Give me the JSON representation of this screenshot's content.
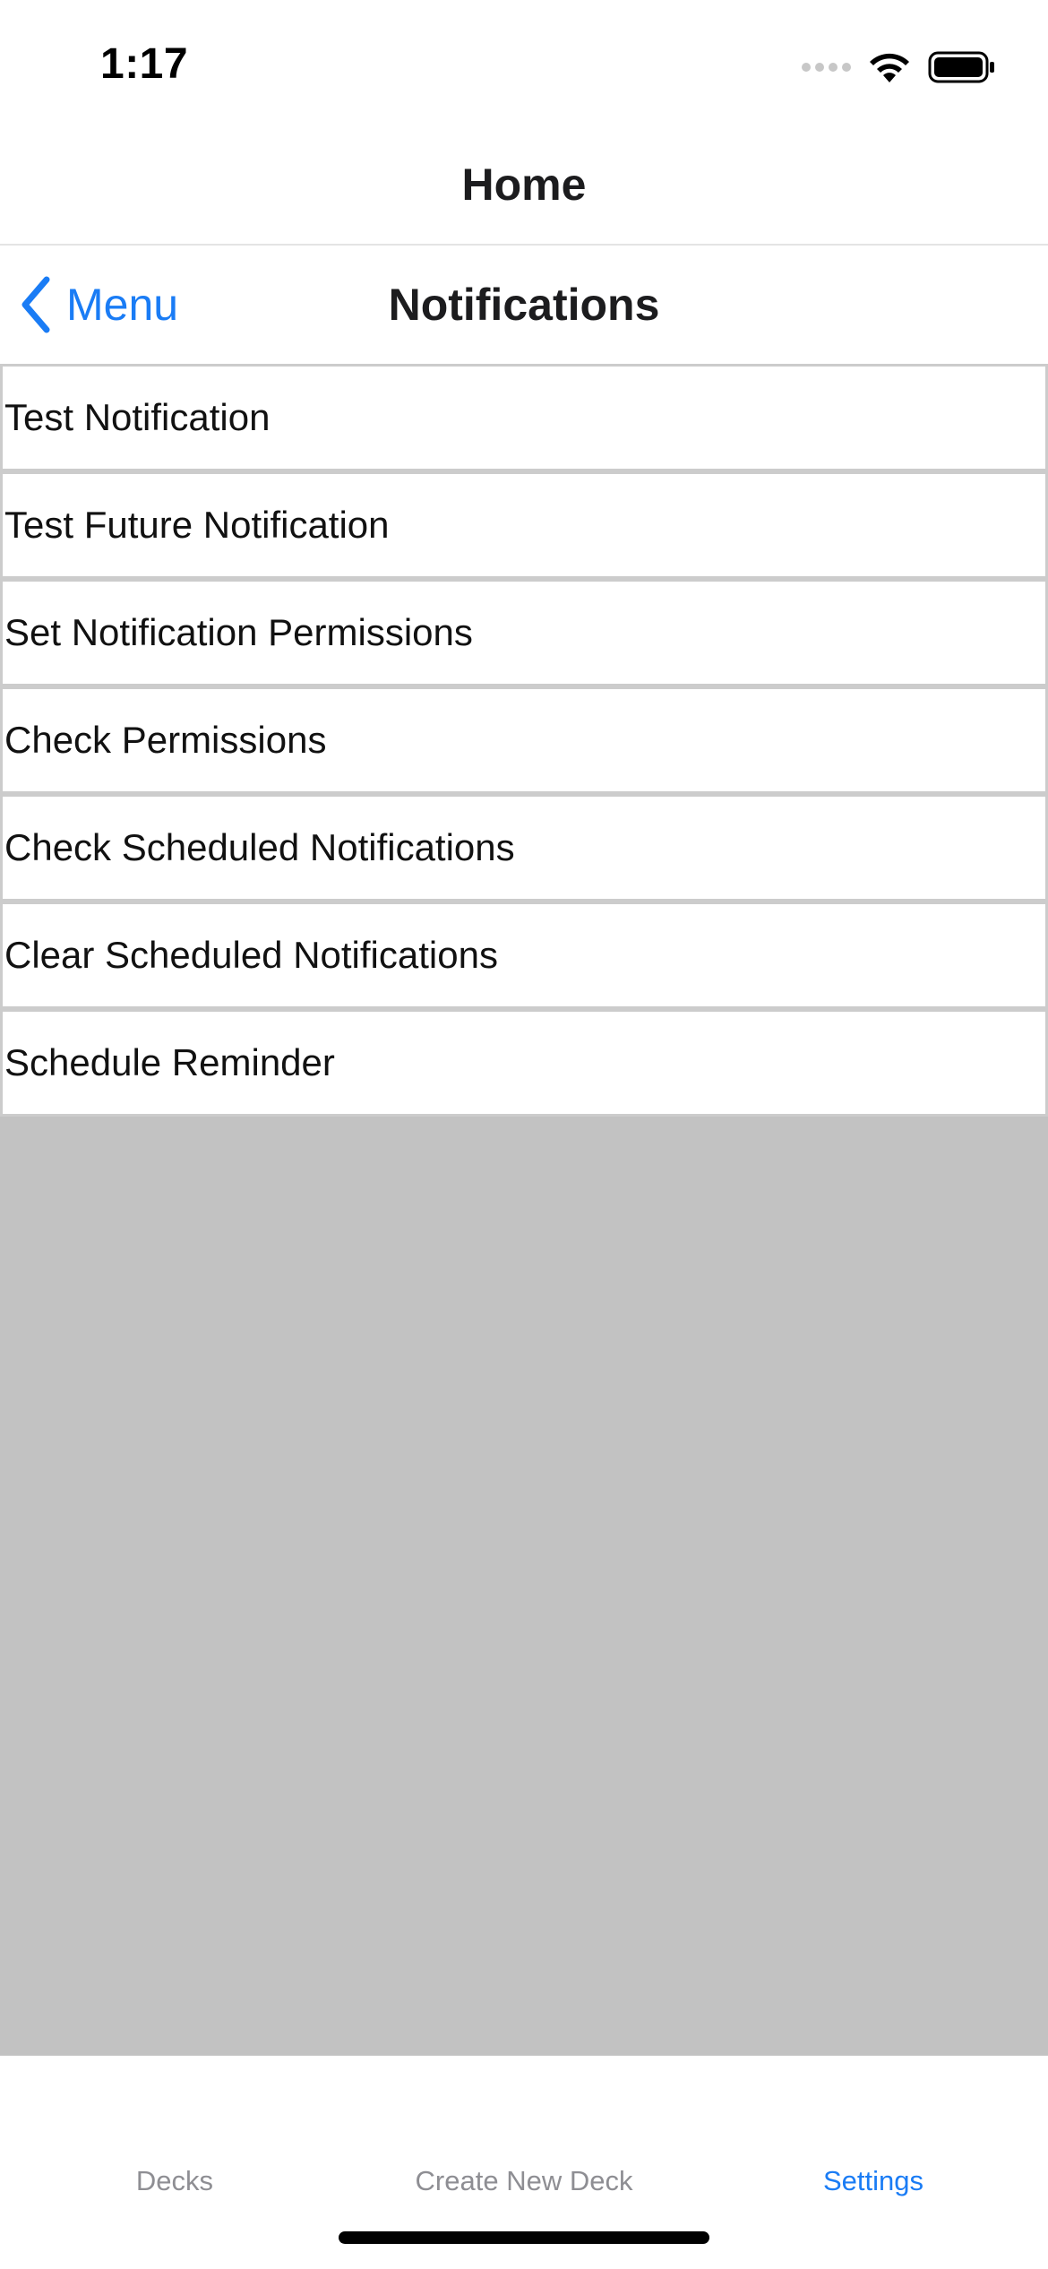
{
  "status_bar": {
    "time": "1:17",
    "icons": [
      "cellular-signal-icon",
      "wifi-icon",
      "battery-icon"
    ]
  },
  "header": {
    "title": "Home"
  },
  "nav_bar": {
    "back_label": "Menu",
    "back_icon": "chevron-left-icon",
    "title": "Notifications"
  },
  "notifications": {
    "items": [
      {
        "label": "Test Notification"
      },
      {
        "label": "Test Future Notification"
      },
      {
        "label": "Set Notification Permissions"
      },
      {
        "label": "Check Permissions"
      },
      {
        "label": "Check Scheduled Notifications"
      },
      {
        "label": "Clear Scheduled Notifications"
      },
      {
        "label": "Schedule Reminder"
      }
    ]
  },
  "tab_bar": {
    "tabs": [
      {
        "label": "Decks",
        "active": false
      },
      {
        "label": "Create New Deck",
        "active": false
      },
      {
        "label": "Settings",
        "active": true
      }
    ]
  },
  "colors": {
    "accent": "#1a7cf5",
    "inactive_tab": "#8e8e93",
    "content_background": "#c2c2c2",
    "item_border": "#cccccc"
  }
}
